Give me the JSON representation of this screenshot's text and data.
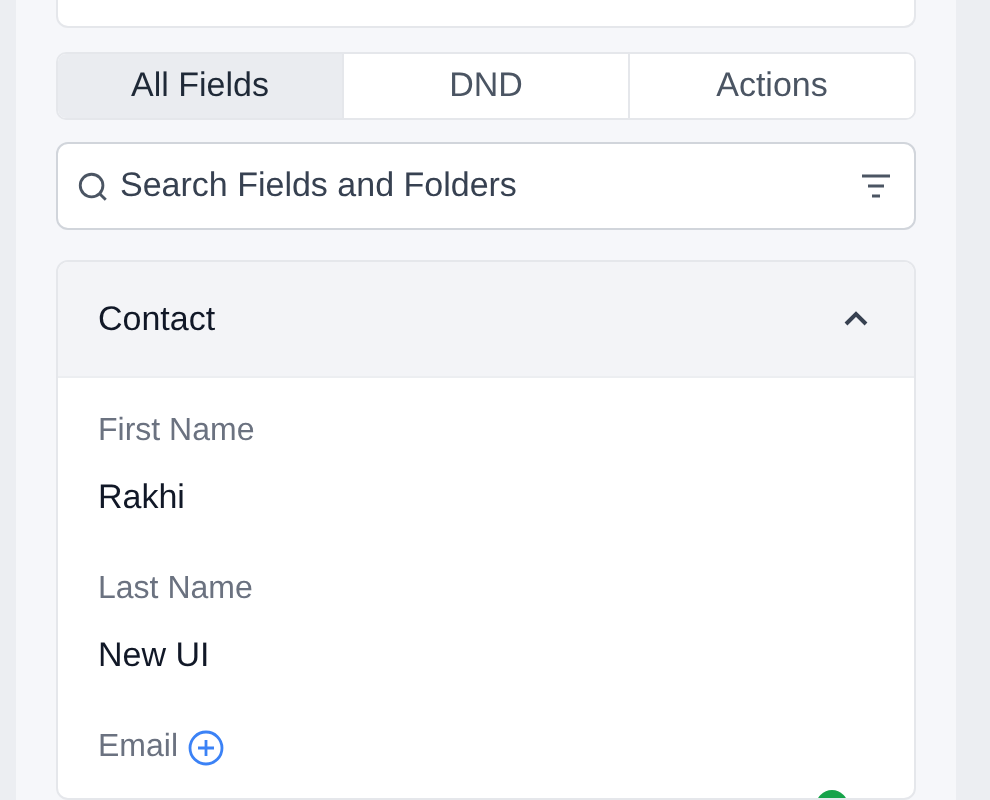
{
  "tabs": [
    {
      "label": "All Fields",
      "selected": true
    },
    {
      "label": "DND",
      "selected": false
    },
    {
      "label": "Actions",
      "selected": false
    }
  ],
  "search": {
    "placeholder": "Search Fields and Folders"
  },
  "section": {
    "title": "Contact",
    "expanded": true,
    "fields": [
      {
        "label": "First Name",
        "value": "Rakhi",
        "kind": "text"
      },
      {
        "label": "Last Name",
        "value": "New UI",
        "kind": "text"
      },
      {
        "label": "Email",
        "kind": "addable"
      }
    ]
  }
}
